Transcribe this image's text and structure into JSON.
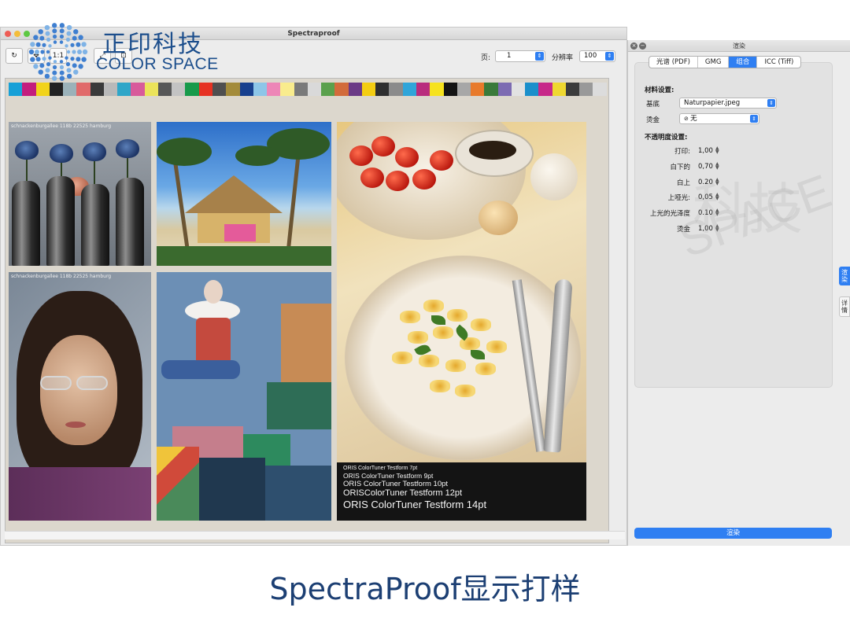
{
  "logo": {
    "cn": "正印科技",
    "en": "COLOR SPACE"
  },
  "window": {
    "title": "Spectraproof",
    "toolbar": {
      "zoom_label": "1:1",
      "page_label": "页:",
      "page_value": "1",
      "resolution_label": "分辨率",
      "resolution_value": "100"
    }
  },
  "proof": {
    "colorbar": [
      "#17a0d7",
      "#c31d7d",
      "#f2d31a",
      "#222222",
      "#9bb2b9",
      "#e16a6a",
      "#3a3a3a",
      "#b9b9b9",
      "#2fa6c8",
      "#d85a9b",
      "#ebe35a",
      "#575757",
      "#c3c3c3",
      "#179a4a",
      "#e63222",
      "#4f4f4f",
      "#a38b3a",
      "#18408e",
      "#8dc6e8",
      "#ed86b7",
      "#f9ec8d",
      "#7a7a7a",
      "#d9d9d9",
      "#5aa04c",
      "#d26b3b",
      "#6b3a86",
      "#f4cd12",
      "#2f2f2f",
      "#8b8b8b",
      "#30a5d9",
      "#b92c7d",
      "#f6e21e",
      "#141414",
      "#a7a7a7",
      "#e87a2b",
      "#3a7a3a",
      "#7d6bb2",
      "#e2e2e2",
      "#1a8fcb",
      "#c72889",
      "#efd830",
      "#3c3c3c",
      "#999999",
      "#dcdcdc"
    ],
    "caption_1": "schnackenburgallee 118b 22525 hamburg",
    "caption_3": "schnackenburgallee 118b 22525 hamburg",
    "typelines": [
      "ORIS ColorTuner Testform 7pt",
      "ORIS ColorTuner Testform 9pt",
      "ORIS ColorTuner Testform 10pt",
      "ORISColorTuner Testform 12pt",
      "ORIS ColorTuner Testform 14pt"
    ]
  },
  "panel": {
    "title": "渲染",
    "tabs": [
      "光谱 (PDF)",
      "GMG",
      "组合",
      "ICC (Tiff)"
    ],
    "active_tab": 2,
    "material_heading": "材料设置:",
    "substrate_label": "基底",
    "substrate_value": "Naturpapier.jpeg",
    "foil_label": "烫金",
    "foil_value": "无",
    "opacity_heading": "不透明度设置:",
    "opacity": [
      {
        "label": "打印:",
        "value": "1,00"
      },
      {
        "label": "白下的",
        "value": "0,70"
      },
      {
        "label": "白上",
        "value": "0.20"
      },
      {
        "label": "上哑光:",
        "value": "0,05"
      },
      {
        "label": "上光的光泽度",
        "value": "0.10"
      },
      {
        "label": "烫金",
        "value": "1,00"
      }
    ],
    "render_button": "渲染",
    "side_tabs": [
      "渲染",
      "详情"
    ]
  },
  "caption": "SpectraProof显示打样"
}
